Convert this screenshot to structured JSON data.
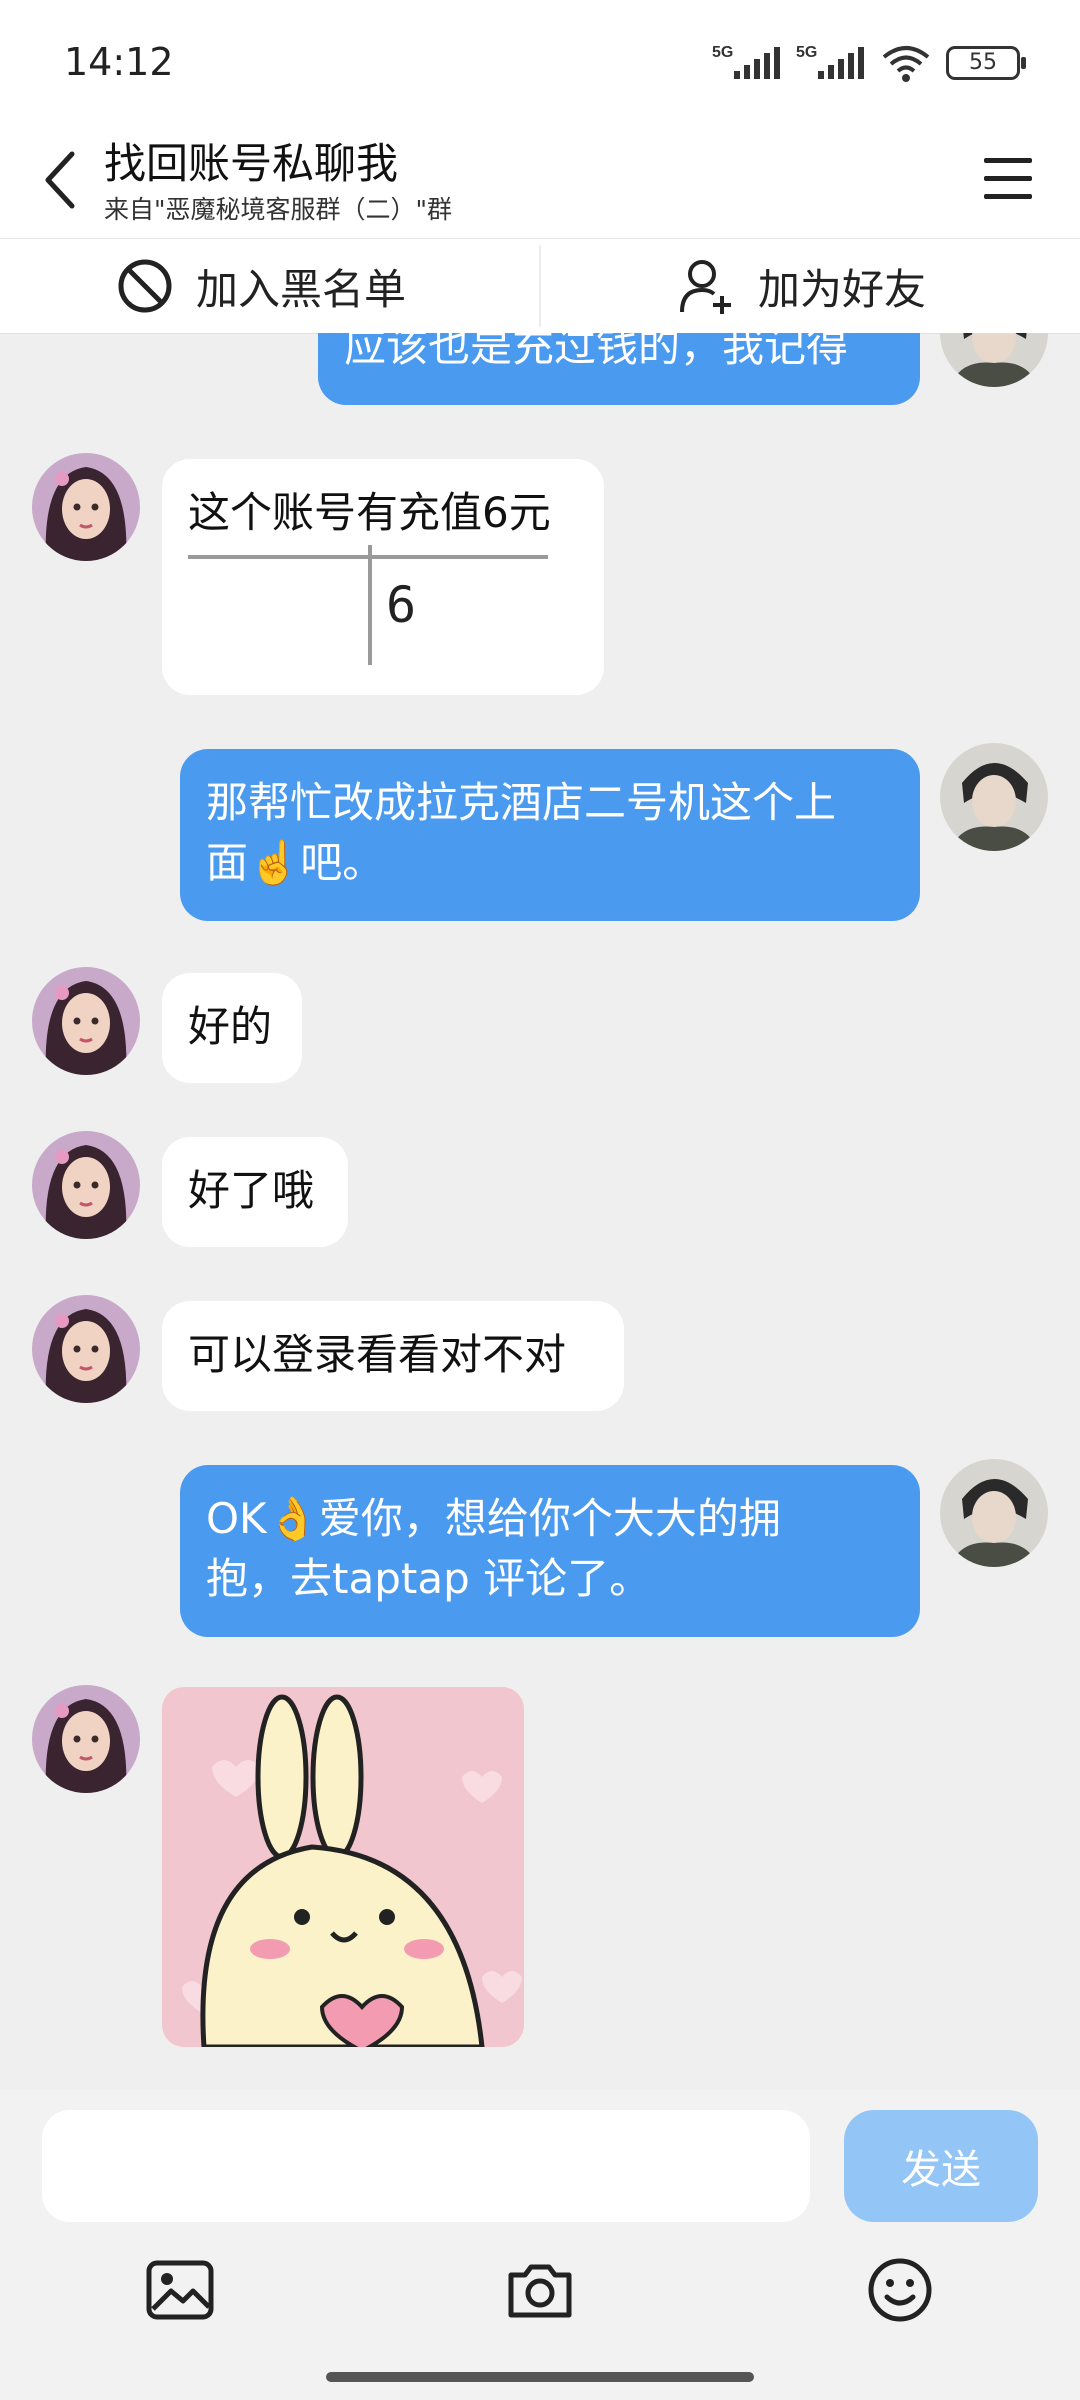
{
  "status": {
    "time": "14:12",
    "battery": "55",
    "network_1": "5G",
    "network_2": "5G"
  },
  "header": {
    "title": "找回账号私聊我",
    "subtitle": "来自\"恶魔秘境客服群（二）\"群"
  },
  "actions": {
    "block_label": "加入黑名单",
    "add_friend_label": "加为好友"
  },
  "messages": [
    {
      "from": "me",
      "text": "应该也是充过钱的，我记得"
    },
    {
      "from": "them",
      "text": "这个账号有充值6元",
      "table_value": "6"
    },
    {
      "from": "me",
      "line1": "那帮忙改成拉克酒店二号机这个上",
      "line2": "面☝️吧。"
    },
    {
      "from": "them",
      "text": "好的"
    },
    {
      "from": "them",
      "text": "好了哦"
    },
    {
      "from": "them",
      "text": "可以登录看看对不对"
    },
    {
      "from": "me",
      "line1": "OK👌爱你，想给你个大大的拥",
      "line2": "抱，去taptap 评论了。"
    },
    {
      "from": "them",
      "type": "sticker",
      "sticker": "bunny-heart-sticker"
    }
  ],
  "composer": {
    "send_label": "发送",
    "input_value": ""
  },
  "colors": {
    "outgoing_bubble": "#4a9aef",
    "incoming_bubble": "#ffffff",
    "send_disabled": "#93c5f6",
    "background": "#efefef"
  }
}
